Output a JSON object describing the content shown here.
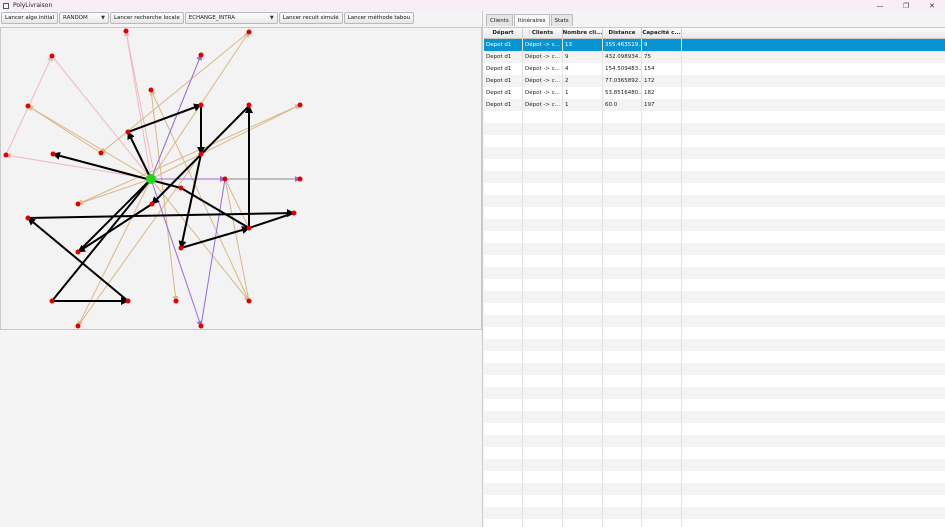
{
  "window": {
    "title": "PolyLivraison",
    "minimize": "—",
    "maximize": "❐",
    "close": "✕"
  },
  "toolbar": {
    "initial_algo": "Lancer algo initial",
    "algo_select": "RANDOM",
    "local_search": "Lancer recherche locale",
    "neighbor_select": "ECHANGE_INTRA",
    "simulated_annealing": "Lancer recuit simulé",
    "tabu": "Lancer méthode tabou"
  },
  "tabs": [
    "Clients",
    "Itinéraires",
    "Stats"
  ],
  "active_tab": 1,
  "table": {
    "headers": [
      "Départ",
      "Clients",
      "Nombre cli...",
      "Distance",
      "Capacité c..."
    ],
    "rows": [
      [
        "Depot d1",
        "Dépot -> c...",
        "13",
        "355.463519...",
        "9"
      ],
      [
        "Depot d1",
        "Dépot -> c...",
        "9",
        "432.098934...",
        "75"
      ],
      [
        "Depot d1",
        "Dépot -> c...",
        "4",
        "154.509483...",
        "154"
      ],
      [
        "Depot d1",
        "Dépot -> c...",
        "2",
        "77.0365892...",
        "172"
      ],
      [
        "Depot d1",
        "Dépot -> c...",
        "1",
        "53.8516480...",
        "182"
      ],
      [
        "Depot d1",
        "Dépot -> c...",
        "1",
        "60.0",
        "197"
      ]
    ],
    "selected_row": 0,
    "empty_rows": 35
  },
  "graph": {
    "depot_color": "#1ed61e",
    "node_color": "#e00000",
    "route_colors": [
      "#000000",
      "#d8b888",
      "#a06ad8",
      "#f2b8c0",
      "#8a6ad8"
    ]
  }
}
